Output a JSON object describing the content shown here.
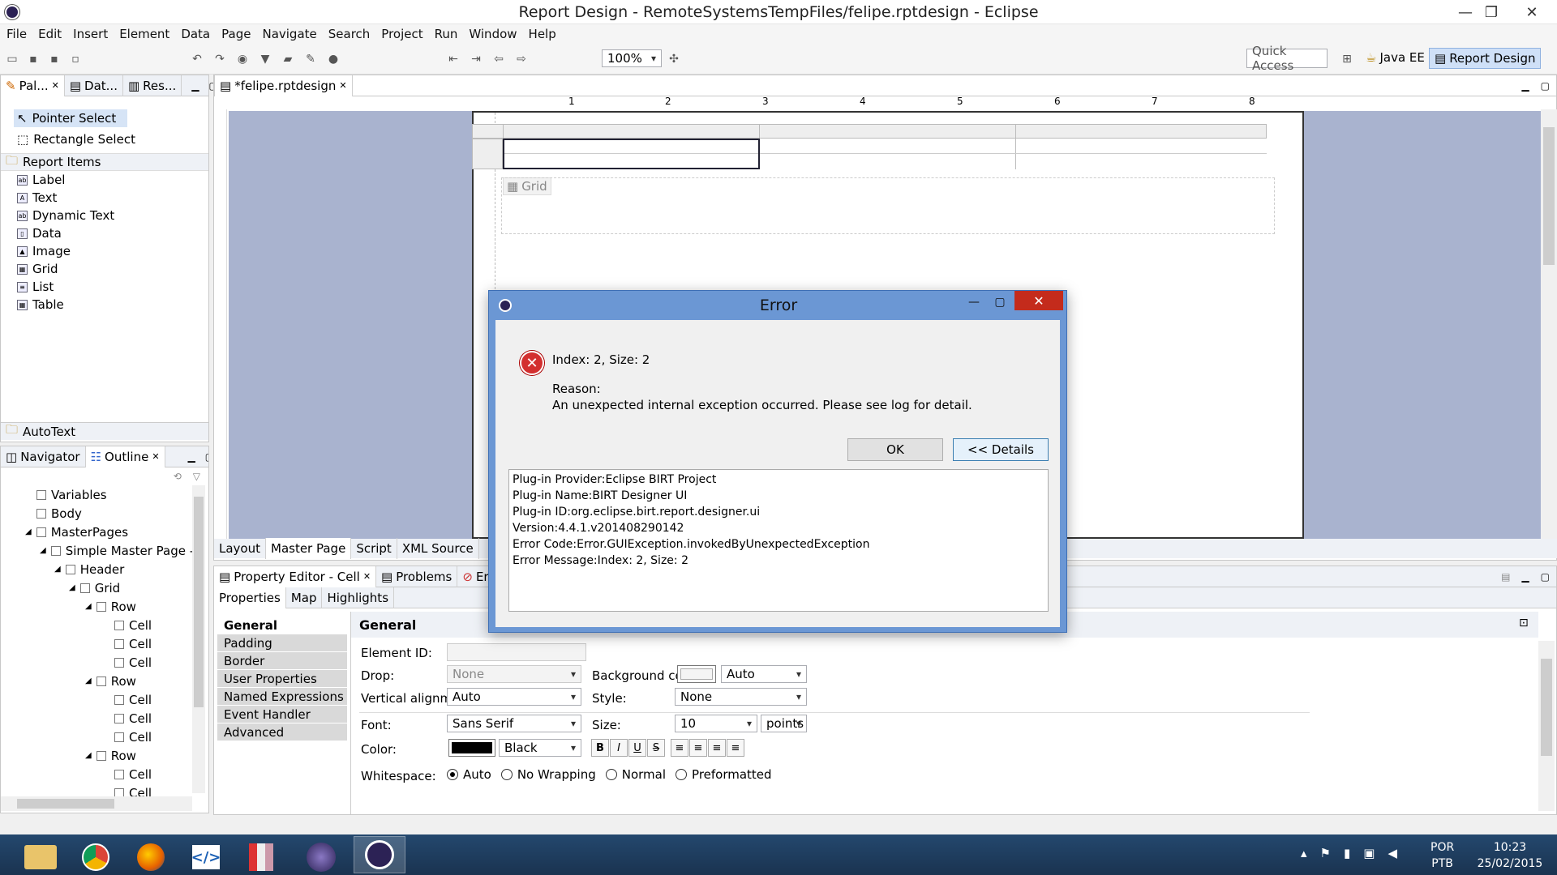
{
  "window": {
    "title": "Report Design - RemoteSystemsTempFiles/felipe.rptdesign - Eclipse"
  },
  "menu": [
    "File",
    "Edit",
    "Insert",
    "Element",
    "Data",
    "Page",
    "Navigate",
    "Search",
    "Project",
    "Run",
    "Window",
    "Help"
  ],
  "toolbar": {
    "zoom": "100%",
    "quick_access": "Quick Access",
    "perspective_javaee": "Java EE",
    "perspective_report": "Report Design"
  },
  "palette": {
    "tabs": [
      "Pal...",
      "Dat...",
      "Res..."
    ],
    "tools": [
      "Pointer Select",
      "Rectangle Select"
    ],
    "section": "Report Items",
    "items": [
      "Label",
      "Text",
      "Dynamic Text",
      "Data",
      "Image",
      "Grid",
      "List",
      "Table"
    ],
    "autotext": "AutoText"
  },
  "outline": {
    "tabs": [
      "Navigator",
      "Outline"
    ],
    "rows": [
      "Variables",
      "Body",
      "MasterPages",
      "Simple Master Page - S",
      "Header",
      "Grid",
      "Row",
      "Cell",
      "Cell",
      "Cell",
      "Row",
      "Cell",
      "Cell",
      "Cell",
      "Row",
      "Cell",
      "Cell"
    ]
  },
  "editor": {
    "tab": "*felipe.rptdesign",
    "ruler": [
      "1",
      "2",
      "3",
      "4",
      "5",
      "6",
      "7",
      "8"
    ],
    "grid_label": "Grid",
    "bottom_tabs": [
      "Layout",
      "Master Page",
      "Script",
      "XML Source"
    ]
  },
  "property_editor": {
    "tabs": [
      "Property Editor - Cell",
      "Problems",
      "Error"
    ],
    "subtabs": [
      "Properties",
      "Map",
      "Highlights"
    ],
    "categories": [
      "General",
      "Padding",
      "Border",
      "User Properties",
      "Named Expressions",
      "Event Handler",
      "Advanced"
    ],
    "section_title": "General",
    "labels": {
      "element_id": "Element ID:",
      "drop": "Drop:",
      "valign": "Vertical alignment:",
      "font": "Font:",
      "color": "Color:",
      "whitespace": "Whitespace:",
      "bgcolor": "Background color:",
      "style": "Style:",
      "size": "Size:"
    },
    "values": {
      "drop": "None",
      "valign": "Auto",
      "font": "Sans Serif",
      "color": "Black",
      "bgcolor": "Auto",
      "style": "None",
      "size": "10",
      "size_unit": "points"
    },
    "whitespace_options": [
      "Auto",
      "No Wrapping",
      "Normal",
      "Preformatted"
    ],
    "format_buttons": [
      "B",
      "I",
      "U",
      "S"
    ]
  },
  "dialog": {
    "title": "Error",
    "message": "Index: 2, Size: 2",
    "reason_label": "Reason:",
    "reason": "An unexpected internal exception occurred. Please see log for detail.",
    "ok": "OK",
    "details": "<< Details",
    "detail_lines": [
      "Plug-in Provider:Eclipse BIRT Project",
      "Plug-in Name:BIRT Designer UI",
      "Plug-in ID:org.eclipse.birt.report.designer.ui",
      "Version:4.4.1.v201408290142",
      "Error Code:Error.GUIException.invokedByUnexpectedException",
      "Error Message:Index: 2, Size: 2"
    ]
  },
  "taskbar": {
    "lang": "POR",
    "layout": "PTB",
    "time": "10:23",
    "date": "25/02/2015"
  },
  "colors": {
    "dialog_blue": "#6b97d4",
    "canvas": "#a9b3cf",
    "close_red": "#c42b1c",
    "taskbar": "#1f3b5c"
  }
}
